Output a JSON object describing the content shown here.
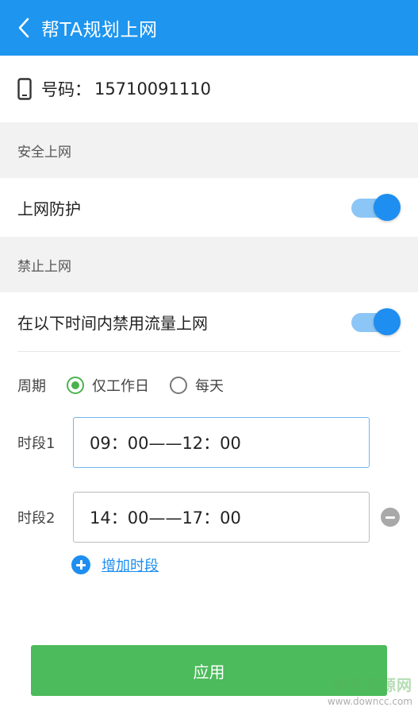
{
  "header": {
    "title": "帮TA规划上网",
    "color": "#1e95ee"
  },
  "phone": {
    "label": "号码：",
    "number": "15710091110"
  },
  "sections": {
    "safe": {
      "title": "安全上网",
      "toggle_label": "上网防护",
      "toggle_on": true
    },
    "block": {
      "title": "禁止上网",
      "toggle_label": "在以下时间内禁用流量上网",
      "toggle_on": true
    }
  },
  "schedule": {
    "period_label": "周期",
    "options": [
      {
        "label": "仅工作日",
        "selected": true
      },
      {
        "label": "每天",
        "selected": false
      }
    ],
    "slots": [
      {
        "label": "时段1",
        "value": "09：00——12：00",
        "removable": false
      },
      {
        "label": "时段2",
        "value": "14：00——17：00",
        "removable": true
      }
    ],
    "add_label": "增加时段"
  },
  "apply_label": "应用",
  "accent_green": "#4cbb5b",
  "watermark": {
    "text": "绿色资源网",
    "url": "www.downcc.com"
  }
}
